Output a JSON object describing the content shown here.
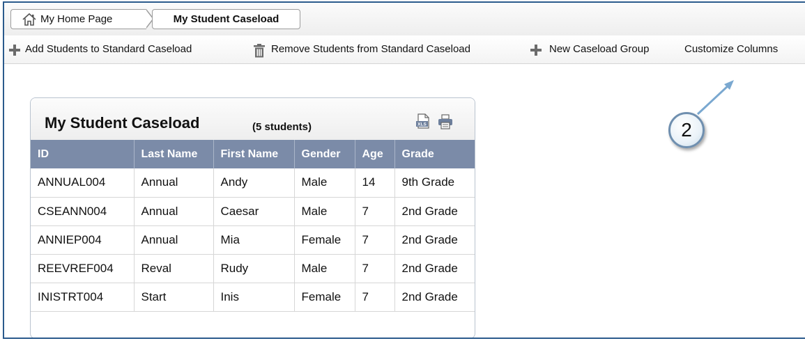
{
  "breadcrumb": {
    "home_label": "My Home Page",
    "current_label": "My Student Caseload"
  },
  "toolbar": {
    "add_label": "Add Students to Standard Caseload",
    "remove_label": "Remove Students from Standard Caseload",
    "new_group_label": "New Caseload Group",
    "customize_label": "Customize Columns"
  },
  "callout": {
    "number": "2"
  },
  "panel": {
    "title": "My Student Caseload",
    "count": "(5 students)",
    "icons": [
      "xls-export-icon",
      "print-icon"
    ]
  },
  "table": {
    "columns": [
      "ID",
      "Last Name",
      "First Name",
      "Gender",
      "Age",
      "Grade"
    ],
    "rows": [
      [
        "ANNUAL004",
        "Annual",
        "Andy",
        "Male",
        "14",
        "9th Grade"
      ],
      [
        "CSEANN004",
        "Annual",
        "Caesar",
        "Male",
        "7",
        "2nd Grade"
      ],
      [
        "ANNIEP004",
        "Annual",
        "Mia",
        "Female",
        "7",
        "2nd Grade"
      ],
      [
        "REEVREF004",
        "Reval",
        "Rudy",
        "Male",
        "7",
        "2nd Grade"
      ],
      [
        "INISTRT004",
        "Start",
        "Inis",
        "Female",
        "7",
        "2nd Grade"
      ]
    ]
  },
  "colors": {
    "header_bg": "#7b8ba8",
    "frame_border": "#2a5a8c",
    "callout_border": "#6f8faf"
  }
}
